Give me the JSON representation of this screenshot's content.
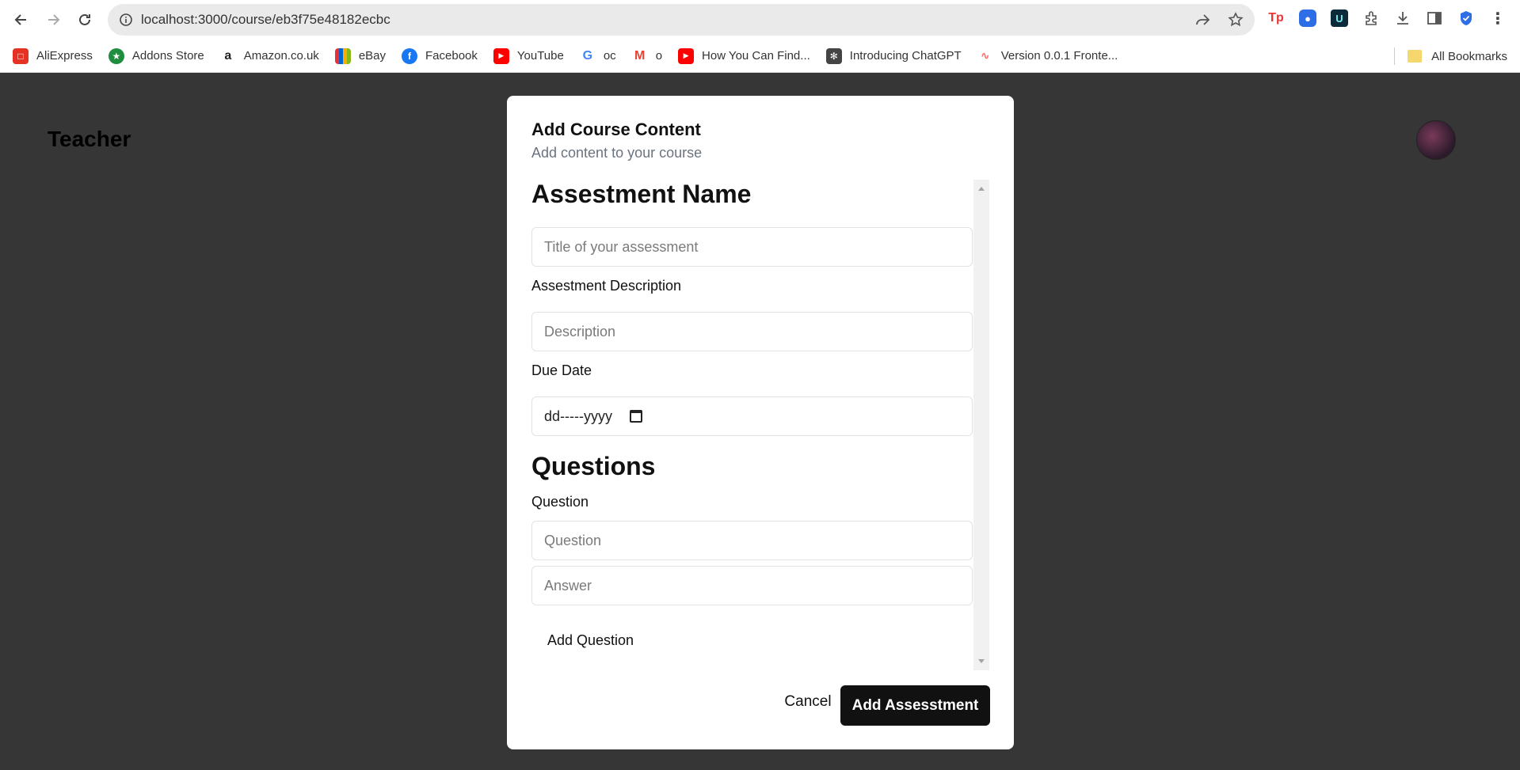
{
  "browser": {
    "url": "localhost:3000/course/eb3f75e48182ecbc",
    "bookmarks": [
      {
        "label": "AliExpress",
        "color": "#e43225"
      },
      {
        "label": "Addons Store",
        "color": "#1e8e3e"
      },
      {
        "label": "Amazon.co.uk",
        "color": "#222222"
      },
      {
        "label": "eBay",
        "color": "#0064d2"
      },
      {
        "label": "Facebook",
        "color": "#1877f2"
      },
      {
        "label": "YouTube",
        "color": "#ff0000"
      },
      {
        "label": "oc",
        "color": "#4285f4"
      },
      {
        "label": "o",
        "color": "#ea4335"
      },
      {
        "label": "How You Can Find...",
        "color": "#ff0000"
      },
      {
        "label": "Introducing ChatGPT",
        "color": "#444444"
      },
      {
        "label": "Version 0.0.1 Fronte...",
        "color": "#ff6b6b"
      }
    ],
    "all_bookmarks": "All Bookmarks"
  },
  "page": {
    "title": "Teacher"
  },
  "modal": {
    "title": "Add Course Content",
    "subtitle": "Add content to your course",
    "assessment_heading": "Assestment Name",
    "name_placeholder": "Title of your assessment",
    "description_label": "Assestment Description",
    "description_placeholder": "Description",
    "due_date_label": "Due Date",
    "due_date_value": "dd-----yyyy",
    "questions_heading": "Questions",
    "question_label": "Question",
    "question_placeholder": "Question",
    "answer_placeholder": "Answer",
    "add_question": "Add Question",
    "cancel": "Cancel",
    "submit": "Add Assesstment"
  }
}
